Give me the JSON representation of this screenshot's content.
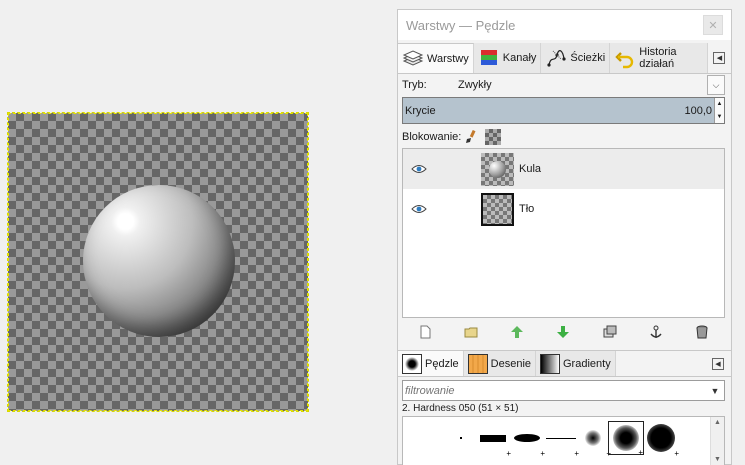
{
  "canvas": {
    "content": "sphere-on-transparent"
  },
  "dock": {
    "title": "Warstwy — Pędzle",
    "close_icon": "close-icon",
    "tabs": [
      {
        "label": "Warstwy",
        "icon": "layers-icon",
        "active": true
      },
      {
        "label": "Kanały",
        "icon": "channels-icon",
        "active": false
      },
      {
        "label": "Ścieżki",
        "icon": "paths-icon",
        "active": false
      },
      {
        "label": "Historia działań",
        "icon": "undo-history-icon",
        "active": false
      }
    ],
    "mode": {
      "label": "Tryb:",
      "value": "Zwykły"
    },
    "opacity": {
      "label": "Krycie",
      "value": "100,0",
      "fraction": 1.0
    },
    "lock": {
      "label": "Blokowanie:"
    },
    "layers": [
      {
        "name": "Kula",
        "visible": true,
        "selected": true
      },
      {
        "name": "Tło",
        "visible": true,
        "selected": false
      }
    ],
    "layer_actions": [
      "new-layer-icon",
      "new-group-icon",
      "raise-layer-icon",
      "lower-layer-icon",
      "duplicate-layer-icon",
      "anchor-icon",
      "delete-layer-icon"
    ],
    "brush_tabs": [
      {
        "label": "Pędzle",
        "icon": "brush-preview-icon",
        "active": true
      },
      {
        "label": "Desenie",
        "icon": "pattern-icon",
        "active": false
      },
      {
        "label": "Gradienty",
        "icon": "gradient-icon",
        "active": false
      }
    ],
    "filter": {
      "placeholder": "filtrowanie"
    },
    "brush_info": "2. Hardness 050 (51 × 51)"
  },
  "colors": {
    "opacity_fill": "#b5c3ce",
    "canvas_dark": "#666666",
    "canvas_light": "#999999",
    "selection_outline": "#e5e500",
    "up_arrow": "#5cb85c",
    "down_arrow": "#3cb043"
  }
}
